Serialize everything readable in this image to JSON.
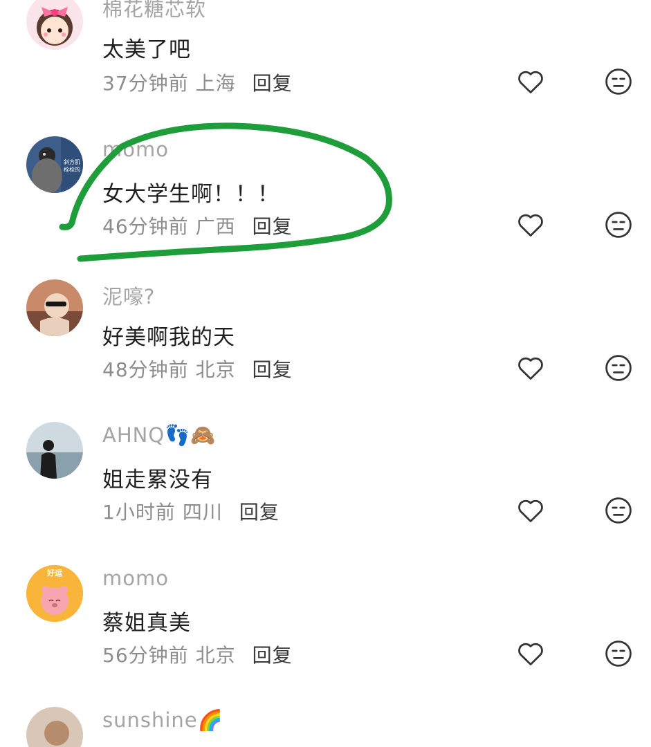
{
  "comments": [
    {
      "username": "棉花糖芯软",
      "text": "太美了吧",
      "time": "37分钟前",
      "location": "上海",
      "reply": "回复"
    },
    {
      "username": "momo",
      "text": "女大学生啊！！！",
      "time": "46分钟前",
      "location": "广西",
      "reply": "回复"
    },
    {
      "username": "泥嚎?",
      "text": "好美啊我的天",
      "time": "48分钟前",
      "location": "北京",
      "reply": "回复"
    },
    {
      "username": "AHNQ👣🙈",
      "text": "姐走累没有",
      "time": "1小时前",
      "location": "四川",
      "reply": "回复"
    },
    {
      "username": "momo",
      "text": "蔡姐真美",
      "time": "56分钟前",
      "location": "北京",
      "reply": "回复"
    },
    {
      "username": "sunshine🌈",
      "text": "",
      "time": "",
      "location": "",
      "reply": ""
    }
  ],
  "avatars": {
    "c1": "斜方肌\n栓栓的",
    "c4": "好运"
  },
  "icons": {
    "like": "heart-outline-icon",
    "dislike": "meh-face-icon"
  },
  "colors": {
    "annotation_stroke": "#1f9d3a",
    "username": "#a4a4a4",
    "text": "#1e1e1e",
    "meta": "#8c8c8c",
    "reply": "#3a3a3a"
  }
}
